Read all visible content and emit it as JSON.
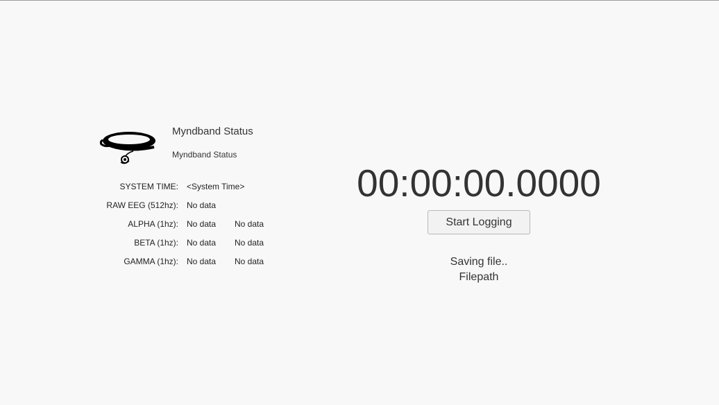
{
  "header": {
    "title": "Myndband Status",
    "subtitle": "Myndband Status",
    "image_icon": "myndband-headband-icon"
  },
  "readouts": [
    {
      "label": "SYSTEM TIME:",
      "value1": "<System Time>",
      "value2": ""
    },
    {
      "label": "RAW EEG (512hz):",
      "value1": "No data",
      "value2": ""
    },
    {
      "label": "ALPHA (1hz):",
      "value1": "No data",
      "value2": "No data"
    },
    {
      "label": "BETA (1hz):",
      "value1": "No data",
      "value2": "No data"
    },
    {
      "label": "GAMMA (1hz):",
      "value1": "No data",
      "value2": "No data"
    }
  ],
  "logging": {
    "timer": "00:00:00.0000",
    "button_label": "Start Logging",
    "saving_text": "Saving file..",
    "filepath_text": "Filepath"
  },
  "colors": {
    "background": "#f8f8f8",
    "text": "#333333",
    "button_bg": "#f2f2f2",
    "button_border": "#b8b8b8"
  }
}
